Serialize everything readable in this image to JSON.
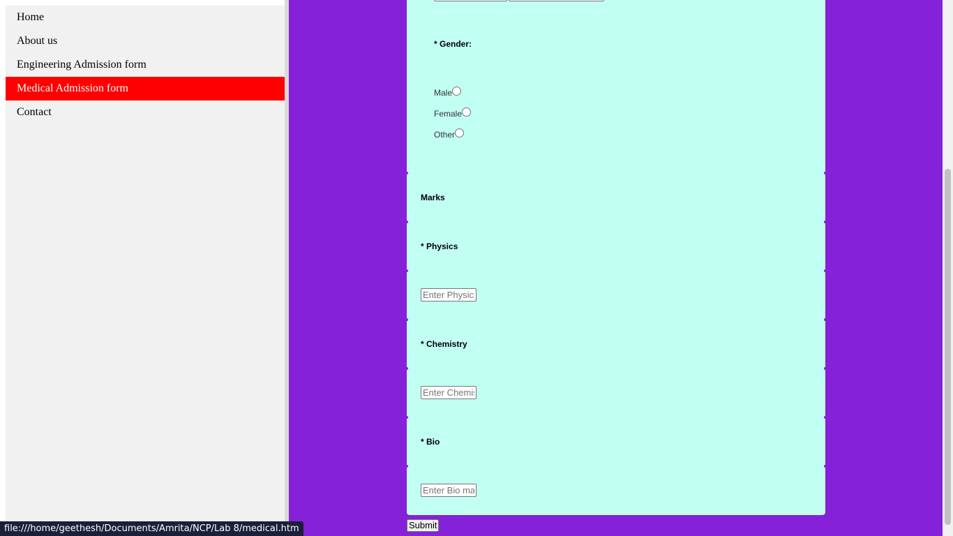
{
  "nav": {
    "items": [
      {
        "label": "Home",
        "active": false
      },
      {
        "label": "About us",
        "active": false
      },
      {
        "label": "Engineering Admission form",
        "active": false
      },
      {
        "label": "Medical Admission form",
        "active": true
      },
      {
        "label": "Contact",
        "active": false
      }
    ]
  },
  "form": {
    "gender_label": "* Gender:",
    "gender_options": [
      "Male",
      "Female",
      "Other"
    ],
    "marks_heading": "Marks",
    "physics_label": "* Physics",
    "physics_placeholder": "Enter Physics marks",
    "chemistry_label": "* Chemistry",
    "chemistry_placeholder": "Enter Chemistry marks",
    "bio_label": "* Bio",
    "bio_placeholder": "Enter Bio marks",
    "submit_label": "Submit"
  },
  "status_bar": {
    "url": "file:///home/geethesh/Documents/Amrita/NCP/Lab 8/medical.htm"
  },
  "colors": {
    "page_bg": "#8421d9",
    "card_bg": "#c1fff3",
    "nav_bg": "#f1f1f1",
    "nav_active": "#ff0000"
  }
}
